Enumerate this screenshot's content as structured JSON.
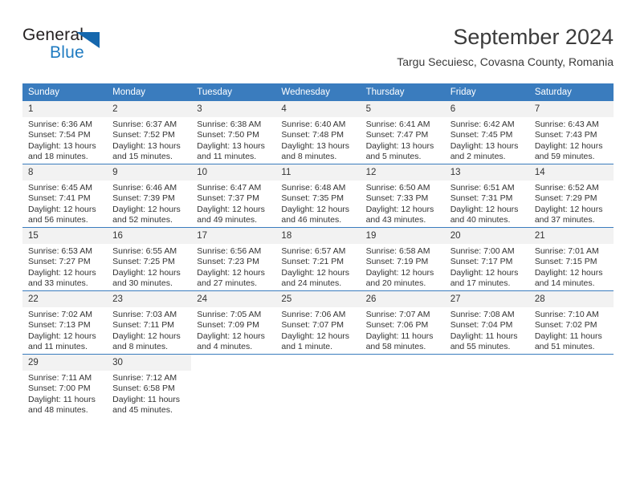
{
  "brand": {
    "name_part1": "General",
    "name_part2": "Blue",
    "triangle_color": "#1567ad",
    "accent_color": "#1f7bc1"
  },
  "header": {
    "title": "September 2024",
    "subtitle": "Targu Secuiesc, Covasna County, Romania"
  },
  "theme": {
    "header_row_bg": "#3a7cbe",
    "header_row_text": "#ffffff",
    "daynum_bg": "#f2f2f2",
    "grid_line": "#3a7cbe",
    "body_text": "#333333"
  },
  "weekday_headers": [
    "Sunday",
    "Monday",
    "Tuesday",
    "Wednesday",
    "Thursday",
    "Friday",
    "Saturday"
  ],
  "weeks": [
    [
      {
        "day": "1",
        "sunrise": "Sunrise: 6:36 AM",
        "sunset": "Sunset: 7:54 PM",
        "daylight_line1": "Daylight: 13 hours",
        "daylight_line2": "and 18 minutes."
      },
      {
        "day": "2",
        "sunrise": "Sunrise: 6:37 AM",
        "sunset": "Sunset: 7:52 PM",
        "daylight_line1": "Daylight: 13 hours",
        "daylight_line2": "and 15 minutes."
      },
      {
        "day": "3",
        "sunrise": "Sunrise: 6:38 AM",
        "sunset": "Sunset: 7:50 PM",
        "daylight_line1": "Daylight: 13 hours",
        "daylight_line2": "and 11 minutes."
      },
      {
        "day": "4",
        "sunrise": "Sunrise: 6:40 AM",
        "sunset": "Sunset: 7:48 PM",
        "daylight_line1": "Daylight: 13 hours",
        "daylight_line2": "and 8 minutes."
      },
      {
        "day": "5",
        "sunrise": "Sunrise: 6:41 AM",
        "sunset": "Sunset: 7:47 PM",
        "daylight_line1": "Daylight: 13 hours",
        "daylight_line2": "and 5 minutes."
      },
      {
        "day": "6",
        "sunrise": "Sunrise: 6:42 AM",
        "sunset": "Sunset: 7:45 PM",
        "daylight_line1": "Daylight: 13 hours",
        "daylight_line2": "and 2 minutes."
      },
      {
        "day": "7",
        "sunrise": "Sunrise: 6:43 AM",
        "sunset": "Sunset: 7:43 PM",
        "daylight_line1": "Daylight: 12 hours",
        "daylight_line2": "and 59 minutes."
      }
    ],
    [
      {
        "day": "8",
        "sunrise": "Sunrise: 6:45 AM",
        "sunset": "Sunset: 7:41 PM",
        "daylight_line1": "Daylight: 12 hours",
        "daylight_line2": "and 56 minutes."
      },
      {
        "day": "9",
        "sunrise": "Sunrise: 6:46 AM",
        "sunset": "Sunset: 7:39 PM",
        "daylight_line1": "Daylight: 12 hours",
        "daylight_line2": "and 52 minutes."
      },
      {
        "day": "10",
        "sunrise": "Sunrise: 6:47 AM",
        "sunset": "Sunset: 7:37 PM",
        "daylight_line1": "Daylight: 12 hours",
        "daylight_line2": "and 49 minutes."
      },
      {
        "day": "11",
        "sunrise": "Sunrise: 6:48 AM",
        "sunset": "Sunset: 7:35 PM",
        "daylight_line1": "Daylight: 12 hours",
        "daylight_line2": "and 46 minutes."
      },
      {
        "day": "12",
        "sunrise": "Sunrise: 6:50 AM",
        "sunset": "Sunset: 7:33 PM",
        "daylight_line1": "Daylight: 12 hours",
        "daylight_line2": "and 43 minutes."
      },
      {
        "day": "13",
        "sunrise": "Sunrise: 6:51 AM",
        "sunset": "Sunset: 7:31 PM",
        "daylight_line1": "Daylight: 12 hours",
        "daylight_line2": "and 40 minutes."
      },
      {
        "day": "14",
        "sunrise": "Sunrise: 6:52 AM",
        "sunset": "Sunset: 7:29 PM",
        "daylight_line1": "Daylight: 12 hours",
        "daylight_line2": "and 37 minutes."
      }
    ],
    [
      {
        "day": "15",
        "sunrise": "Sunrise: 6:53 AM",
        "sunset": "Sunset: 7:27 PM",
        "daylight_line1": "Daylight: 12 hours",
        "daylight_line2": "and 33 minutes."
      },
      {
        "day": "16",
        "sunrise": "Sunrise: 6:55 AM",
        "sunset": "Sunset: 7:25 PM",
        "daylight_line1": "Daylight: 12 hours",
        "daylight_line2": "and 30 minutes."
      },
      {
        "day": "17",
        "sunrise": "Sunrise: 6:56 AM",
        "sunset": "Sunset: 7:23 PM",
        "daylight_line1": "Daylight: 12 hours",
        "daylight_line2": "and 27 minutes."
      },
      {
        "day": "18",
        "sunrise": "Sunrise: 6:57 AM",
        "sunset": "Sunset: 7:21 PM",
        "daylight_line1": "Daylight: 12 hours",
        "daylight_line2": "and 24 minutes."
      },
      {
        "day": "19",
        "sunrise": "Sunrise: 6:58 AM",
        "sunset": "Sunset: 7:19 PM",
        "daylight_line1": "Daylight: 12 hours",
        "daylight_line2": "and 20 minutes."
      },
      {
        "day": "20",
        "sunrise": "Sunrise: 7:00 AM",
        "sunset": "Sunset: 7:17 PM",
        "daylight_line1": "Daylight: 12 hours",
        "daylight_line2": "and 17 minutes."
      },
      {
        "day": "21",
        "sunrise": "Sunrise: 7:01 AM",
        "sunset": "Sunset: 7:15 PM",
        "daylight_line1": "Daylight: 12 hours",
        "daylight_line2": "and 14 minutes."
      }
    ],
    [
      {
        "day": "22",
        "sunrise": "Sunrise: 7:02 AM",
        "sunset": "Sunset: 7:13 PM",
        "daylight_line1": "Daylight: 12 hours",
        "daylight_line2": "and 11 minutes."
      },
      {
        "day": "23",
        "sunrise": "Sunrise: 7:03 AM",
        "sunset": "Sunset: 7:11 PM",
        "daylight_line1": "Daylight: 12 hours",
        "daylight_line2": "and 8 minutes."
      },
      {
        "day": "24",
        "sunrise": "Sunrise: 7:05 AM",
        "sunset": "Sunset: 7:09 PM",
        "daylight_line1": "Daylight: 12 hours",
        "daylight_line2": "and 4 minutes."
      },
      {
        "day": "25",
        "sunrise": "Sunrise: 7:06 AM",
        "sunset": "Sunset: 7:07 PM",
        "daylight_line1": "Daylight: 12 hours",
        "daylight_line2": "and 1 minute."
      },
      {
        "day": "26",
        "sunrise": "Sunrise: 7:07 AM",
        "sunset": "Sunset: 7:06 PM",
        "daylight_line1": "Daylight: 11 hours",
        "daylight_line2": "and 58 minutes."
      },
      {
        "day": "27",
        "sunrise": "Sunrise: 7:08 AM",
        "sunset": "Sunset: 7:04 PM",
        "daylight_line1": "Daylight: 11 hours",
        "daylight_line2": "and 55 minutes."
      },
      {
        "day": "28",
        "sunrise": "Sunrise: 7:10 AM",
        "sunset": "Sunset: 7:02 PM",
        "daylight_line1": "Daylight: 11 hours",
        "daylight_line2": "and 51 minutes."
      }
    ],
    [
      {
        "day": "29",
        "sunrise": "Sunrise: 7:11 AM",
        "sunset": "Sunset: 7:00 PM",
        "daylight_line1": "Daylight: 11 hours",
        "daylight_line2": "and 48 minutes."
      },
      {
        "day": "30",
        "sunrise": "Sunrise: 7:12 AM",
        "sunset": "Sunset: 6:58 PM",
        "daylight_line1": "Daylight: 11 hours",
        "daylight_line2": "and 45 minutes."
      },
      null,
      null,
      null,
      null,
      null
    ]
  ]
}
